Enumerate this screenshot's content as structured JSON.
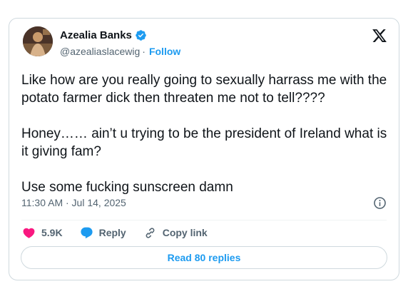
{
  "tweet": {
    "author_name": "Azealia Banks",
    "handle": "@azealiaslacewig",
    "separator": "·",
    "follow_label": "Follow",
    "text": "Like how are you really going to sexually harrass me with the potato farmer dick then threaten me not to tell????\n\nHoney…… ain’t u trying to be the president of Ireland what is it giving fam?\n\nUse some fucking sunscreen damn",
    "timestamp": "11:30 AM · Jul 14, 2025",
    "likes_count": "5.9K",
    "reply_label": "Reply",
    "copy_link_label": "Copy link",
    "read_replies_label": "Read 80 replies"
  },
  "icons": {
    "verified": "verified-badge-icon",
    "logo": "x-logo-icon",
    "info": "info-icon",
    "like": "heart-icon",
    "reply": "chat-bubble-icon",
    "link": "link-icon"
  },
  "colors": {
    "accent": "#1d9bf0",
    "like": "#f91880",
    "text": "#0f1419",
    "muted": "#536471",
    "border": "#cfd9de"
  }
}
